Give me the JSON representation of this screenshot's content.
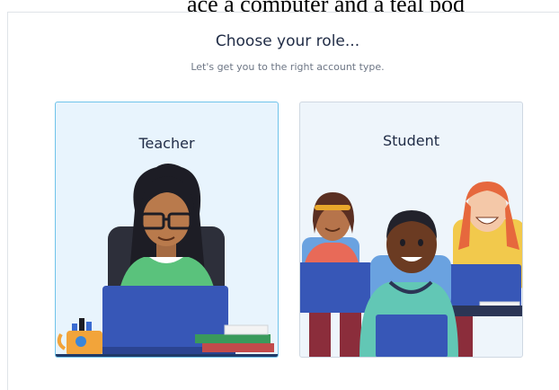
{
  "top_strip": {
    "text": "ace a computer and a teal pod"
  },
  "header": {
    "title": "Choose your role...",
    "subtitle": "Let's get you to the right account type."
  },
  "roles": [
    {
      "label": "Teacher",
      "selected": true
    },
    {
      "label": "Student",
      "selected": false
    }
  ],
  "colors": {
    "selected_border": "#6fc3ea",
    "selected_bg": "#e8f4fd",
    "card_bg": "#eef5fb",
    "heading": "#1f2b45",
    "laptop": "#3757b7"
  },
  "icons": [
    "teacher-illustration",
    "students-illustration",
    "pencil-mug-icon",
    "books-icon"
  ]
}
